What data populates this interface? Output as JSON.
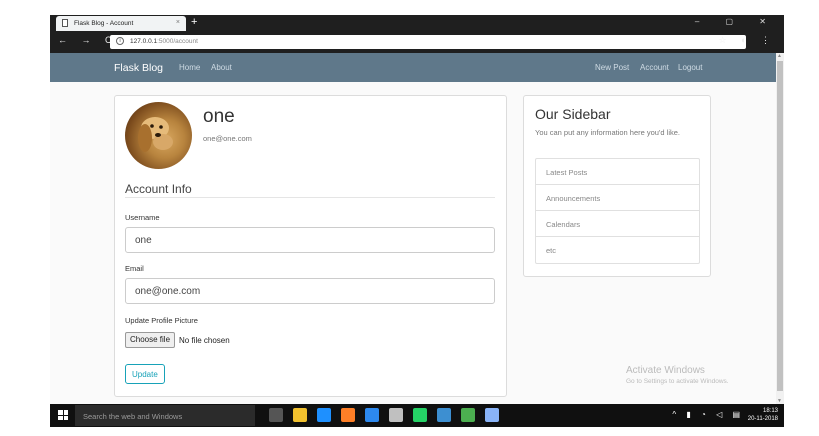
{
  "browser": {
    "tab_title": "Flask Blog - Account",
    "tab_close": "×",
    "new_tab": "+",
    "window_controls": "–  ▢  ✕",
    "nav_buttons": "← → C",
    "url_host": "127.0.0.1",
    "url_path": ":5000/account",
    "info_icon": "i",
    "toolbar_icons": "☆ ◐ ⋮"
  },
  "navbar": {
    "brand": "Flask Blog",
    "left_links": [
      "Home",
      "About"
    ],
    "right_links": [
      "New Post",
      "Account",
      "Logout"
    ],
    "bg_color": "#5f788a"
  },
  "account": {
    "username": "one",
    "email": "one@one.com",
    "legend": "Account Info",
    "username_label": "Username",
    "username_value": "one",
    "email_label": "Email",
    "email_value": "one@one.com",
    "picture_label": "Update Profile Picture",
    "choose_file": "Choose file",
    "no_file": "No file chosen",
    "submit": "Update"
  },
  "sidebar": {
    "title": "Our Sidebar",
    "text": "You can put any information here you'd like.",
    "items": [
      "Latest Posts",
      "Announcements",
      "Calendars",
      "etc"
    ]
  },
  "watermark": {
    "line1": "Activate Windows",
    "line2": "Go to Settings to activate Windows."
  },
  "taskbar": {
    "search_placeholder": "Search the web and Windows",
    "tray": "^ ▮ ◔ ◁ ▤",
    "time": "18:13",
    "date": "20-11-2018",
    "app_icon_colors": [
      "#555555",
      "#f2c12e",
      "#1e90ff",
      "#ff7f27",
      "#2d89ef",
      "#c0c0c0",
      "#25d366",
      "#3d8fd1",
      "#4caf50",
      "#8ab4f8"
    ]
  }
}
